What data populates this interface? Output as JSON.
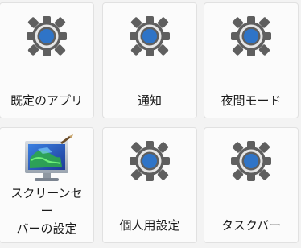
{
  "tiles": [
    {
      "label": "既定のアプリ",
      "icon": "gear-icon"
    },
    {
      "label": "通知",
      "icon": "gear-icon"
    },
    {
      "label": "夜間モード",
      "icon": "gear-icon"
    },
    {
      "label": "スクリーンセー\nバーの設定",
      "icon": "screensaver-monitor-icon"
    },
    {
      "label": "個人用設定",
      "icon": "gear-icon"
    },
    {
      "label": "タスクバー",
      "icon": "gear-icon"
    }
  ],
  "colors": {
    "gear": "#5f5f5f",
    "gear_center": "#2f74c7",
    "tile_bg": "#fbfbfb",
    "page_bg": "#f3f3f3"
  }
}
